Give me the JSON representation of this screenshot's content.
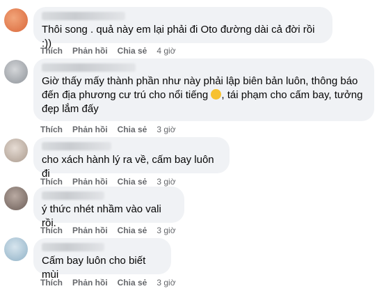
{
  "comments": [
    {
      "text": "Thôi song . quả này em lại phải đi Oto đường dài cả đời rồi :))",
      "like": "Thích",
      "reply": "Phản hồi",
      "share": "Chia sẻ",
      "time": "4 giờ",
      "avatar_color": "#e88a5c"
    },
    {
      "text_before": "Giờ thấy mấy thành phần như này phải lập biên bản luôn, thông báo\nđến địa phương cư trú cho nổi tiếng ",
      "text_after": ", tái phạm cho cấm bay, tưởng\nđẹp lắm đấy",
      "emoji": "laughing-face-icon",
      "like": "Thích",
      "reply": "Phản hồi",
      "share": "Chia sẻ",
      "time": "3 giờ",
      "avatar_color": "#b8bcc2"
    },
    {
      "text": "cho xách hành lý ra về, cấm bay luôn đi",
      "like": "Thích",
      "reply": "Phản hồi",
      "share": "Chia sẻ",
      "time": "3 giờ",
      "avatar_color": "#cdbfb4"
    },
    {
      "text": "ý thức nhét nhầm vào vali rồi.",
      "like": "Thích",
      "reply": "Phản hồi",
      "share": "Chia sẻ",
      "time": "3 giờ",
      "avatar_color": "#9a8c86"
    },
    {
      "text": "Cấm bay luôn cho biết mùi",
      "like": "Thích",
      "reply": "Phản hồi",
      "share": "Chia sẻ",
      "time": "3 giờ",
      "avatar_color": "#b9d0df"
    }
  ]
}
